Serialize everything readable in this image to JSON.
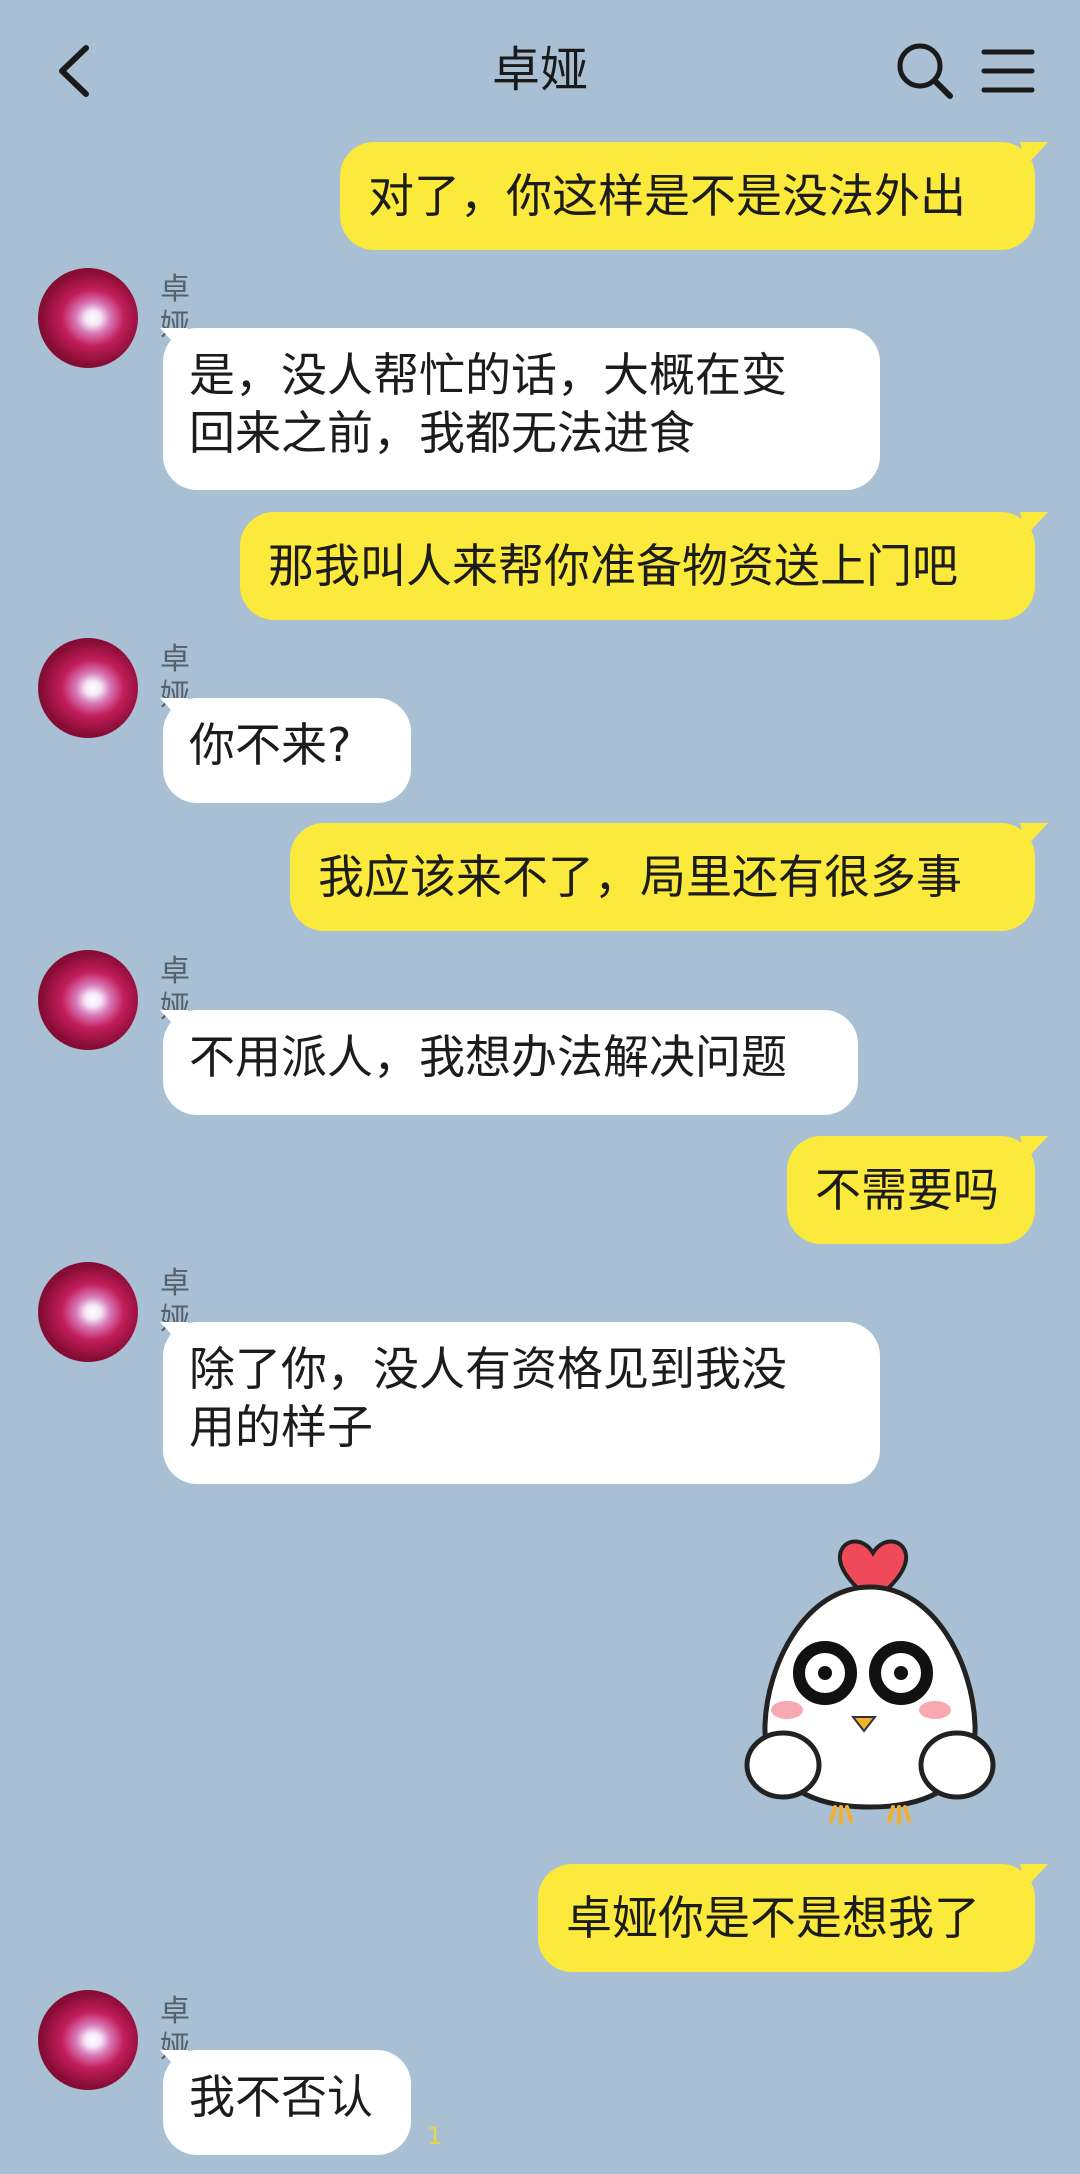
{
  "header": {
    "title": "卓娅"
  },
  "contact": {
    "name": "卓娅"
  },
  "messages": [
    {
      "from": "me",
      "text": "对了，你这样是不是没法外出"
    },
    {
      "from": "them",
      "lines": [
        "是，没人帮忙的话，大概在变",
        "回来之前，我都无法进食"
      ]
    },
    {
      "from": "me",
      "text": "那我叫人来帮你准备物资送上门吧"
    },
    {
      "from": "them",
      "lines": [
        "你不来?"
      ]
    },
    {
      "from": "me",
      "text": "我应该来不了，局里还有很多事"
    },
    {
      "from": "them",
      "lines": [
        "不用派人，我想办法解决问题"
      ]
    },
    {
      "from": "me",
      "text": "不需要吗"
    },
    {
      "from": "them",
      "lines": [
        "除了你，没人有资格见到我没",
        "用的样子"
      ]
    },
    {
      "from": "me",
      "type": "sticker",
      "sticker": "chick-heart-sticker"
    },
    {
      "from": "me",
      "text": "卓娅你是不是想我了"
    },
    {
      "from": "them",
      "lines": [
        "我不否认"
      ]
    }
  ],
  "unread_badge": "1",
  "colors": {
    "background": "#a9bfd3",
    "my_bubble": "#fbe93c",
    "their_bubble": "#ffffff"
  }
}
